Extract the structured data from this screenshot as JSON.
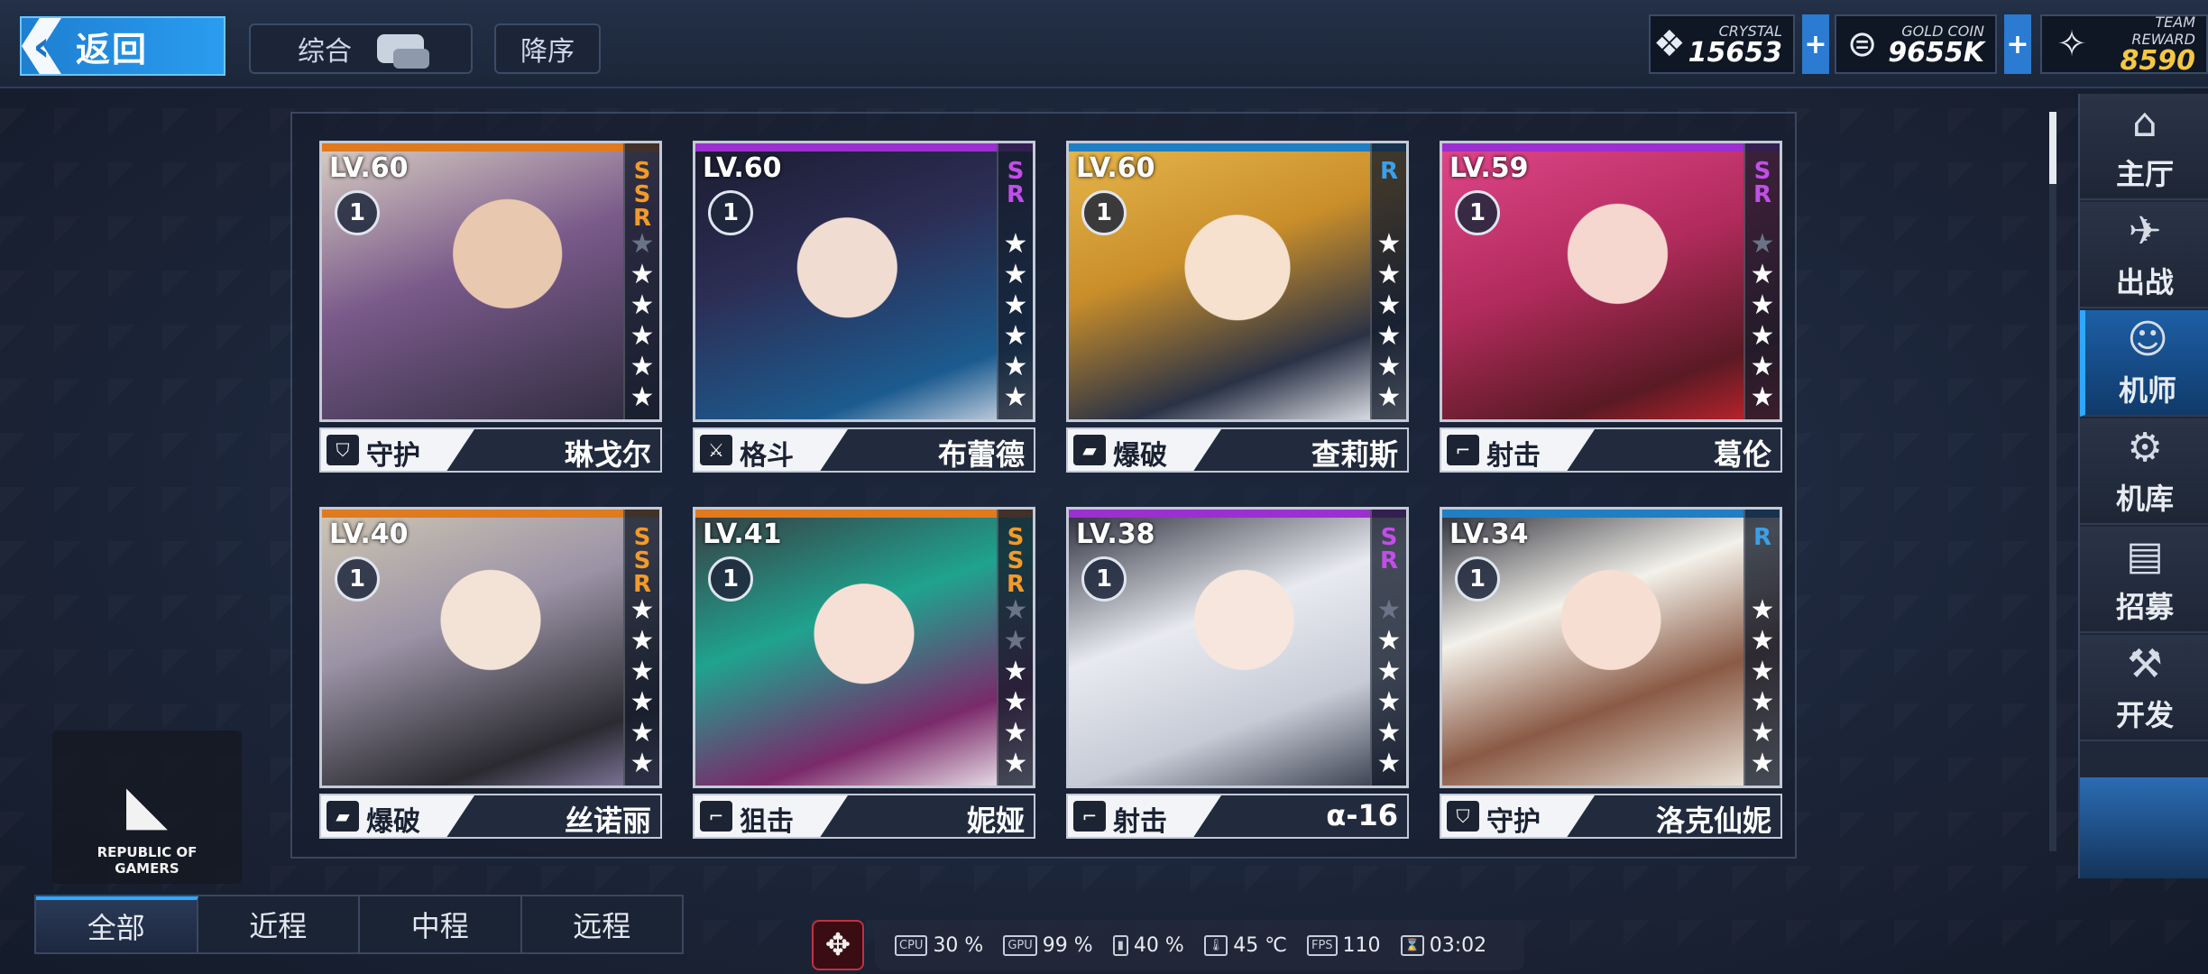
{
  "header": {
    "back_label": "返回",
    "sort_category": "综合",
    "sort_order": "降序"
  },
  "currencies": [
    {
      "name": "CRYSTAL",
      "value": "15653",
      "icon": "crystal-icon"
    },
    {
      "name": "GOLD COIN",
      "value": "9655K",
      "icon": "gold-coin-icon"
    },
    {
      "name": "TEAM REWARD",
      "value": "8590",
      "icon": "team-reward-icon",
      "color": "#f5c744"
    }
  ],
  "cards": [
    {
      "level": "LV.60",
      "rank": "1",
      "rarity": "SSR",
      "rarity_color": "#f39a2a",
      "role": "守护",
      "role_icon": "shield-icon",
      "name": "琳戈尔",
      "stars": 5,
      "max_stars": 6
    },
    {
      "level": "LV.60",
      "rank": "1",
      "rarity": "SR",
      "rarity_color": "#c24ee8",
      "role": "格斗",
      "role_icon": "crossed-swords-icon",
      "name": "布蕾德",
      "stars": 6,
      "max_stars": 6
    },
    {
      "level": "LV.60",
      "rank": "1",
      "rarity": "R",
      "rarity_color": "#3aa0e8",
      "role": "爆破",
      "role_icon": "blaster-icon",
      "name": "查莉斯",
      "stars": 6,
      "max_stars": 6
    },
    {
      "level": "LV.59",
      "rank": "1",
      "rarity": "SR",
      "rarity_color": "#c24ee8",
      "role": "射击",
      "role_icon": "rifle-icon",
      "name": "葛伦",
      "stars": 5,
      "max_stars": 6
    },
    {
      "level": "LV.40",
      "rank": "1",
      "rarity": "SSR",
      "rarity_color": "#f39a2a",
      "role": "爆破",
      "role_icon": "blaster-icon",
      "name": "丝诺丽",
      "stars": 6,
      "max_stars": 6
    },
    {
      "level": "LV.41",
      "rank": "1",
      "rarity": "SSR",
      "rarity_color": "#f39a2a",
      "role": "狙击",
      "role_icon": "sniper-icon",
      "name": "妮娅",
      "stars": 4,
      "max_stars": 6
    },
    {
      "level": "LV.38",
      "rank": "1",
      "rarity": "SR",
      "rarity_color": "#c24ee8",
      "role": "射击",
      "role_icon": "rifle-icon",
      "name": "α-16",
      "stars": 5,
      "max_stars": 6
    },
    {
      "level": "LV.34",
      "rank": "1",
      "rarity": "R",
      "rarity_color": "#3aa0e8",
      "role": "守护",
      "role_icon": "shield-icon",
      "name": "洛克仙妮",
      "stars": 6,
      "max_stars": 6
    }
  ],
  "side_nav": [
    {
      "label": "主厅",
      "icon": "lobby-icon",
      "active": false
    },
    {
      "label": "出战",
      "icon": "sortie-icon",
      "active": false
    },
    {
      "label": "机师",
      "icon": "pilot-icon",
      "active": true
    },
    {
      "label": "机库",
      "icon": "hangar-icon",
      "active": false
    },
    {
      "label": "招募",
      "icon": "recruit-icon",
      "active": false,
      "badge": "0"
    },
    {
      "label": "开发",
      "icon": "develop-icon",
      "active": false,
      "badge": "0"
    }
  ],
  "range_tabs": [
    {
      "label": "全部",
      "active": true
    },
    {
      "label": "近程",
      "active": false
    },
    {
      "label": "中程",
      "active": false
    },
    {
      "label": "远程",
      "active": false
    }
  ],
  "rog": {
    "line1": "REPUBLIC OF",
    "line2": "GAMERS"
  },
  "perf": {
    "cpu": "30 %",
    "gpu": "99 %",
    "battery": "40 %",
    "temp": "45 ℃",
    "fps": "110",
    "time": "03:02"
  }
}
